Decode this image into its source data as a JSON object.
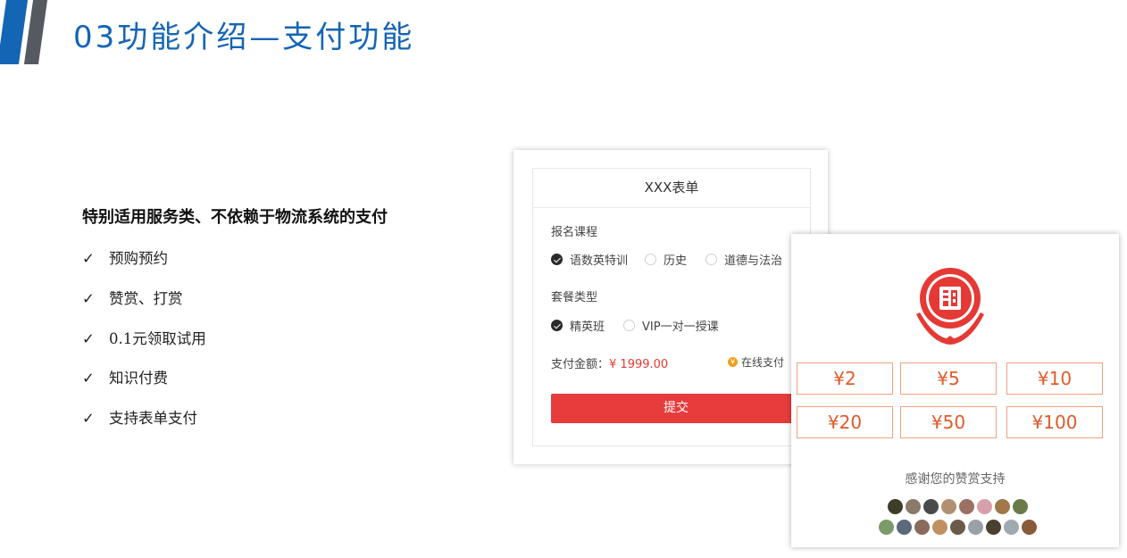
{
  "header": {
    "title": "03功能介绍—支付功能",
    "accent": "#1565b5"
  },
  "left": {
    "lead": "特别适用服务类、不依赖于物流系统的支付",
    "check_glyph": "✓",
    "features": [
      "预购预约",
      "赞赏、打赏",
      "0.1元领取试用",
      "知识付费",
      "支持表单支付"
    ]
  },
  "form": {
    "title": "XXX表单",
    "course_label": "报名课程",
    "courses": [
      {
        "label": "语数英特训",
        "selected": true
      },
      {
        "label": "历史",
        "selected": false
      },
      {
        "label": "道德与法治",
        "selected": false
      }
    ],
    "package_label": "套餐类型",
    "packages": [
      {
        "label": "精英班",
        "selected": true
      },
      {
        "label": "VIP一对一授课",
        "selected": false
      }
    ],
    "amount_label": "支付金额：",
    "amount_value": "¥ 1999.00",
    "pay_method": "在线支付",
    "pay_icon": "coin-icon",
    "submit": "提交",
    "submit_color": "#e63c3c"
  },
  "reward": {
    "seal_icon": "red-seal-logo",
    "amounts": [
      "¥2",
      "¥5",
      "¥10",
      "¥20",
      "¥50",
      "¥100"
    ],
    "thanks": "感谢您的赞赏支持",
    "brand_color": "#e53935"
  }
}
